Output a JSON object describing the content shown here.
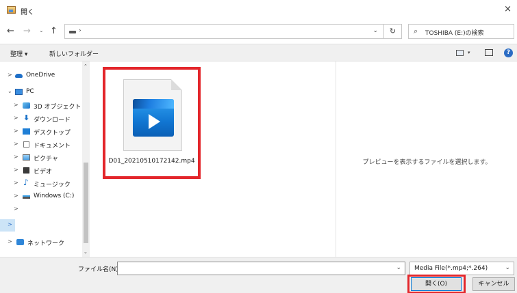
{
  "window": {
    "title": "開く",
    "close_glyph": "×"
  },
  "address_bar": {
    "back_glyph": "←",
    "forward_glyph": "→",
    "recent_glyph": "⌄",
    "up_glyph": "↑",
    "separator": "›",
    "dropdown_glyph": "⌄",
    "refresh_glyph": "↻",
    "search_placeholder": "TOSHIBA (E:)の検索",
    "search_icon_glyph": "⌕"
  },
  "toolbar": {
    "organize_label": "整理 ▾",
    "new_folder_label": "新しいフォルダー",
    "view_dropdown_glyph": "▾",
    "help_glyph": "?"
  },
  "nav_pane": {
    "items": [
      {
        "label": "OneDrive",
        "chevron": ">",
        "icon": "onedrive-cloud-icon"
      },
      {
        "label": "PC",
        "chevron": "⌄",
        "icon": "pc-icon"
      },
      {
        "label": "3D オブジェクト",
        "chevron": ">",
        "icon": "3d-objects-icon"
      },
      {
        "label": "ダウンロード",
        "chevron": ">",
        "icon": "download-icon"
      },
      {
        "label": "デスクトップ",
        "chevron": ">",
        "icon": "desktop-icon"
      },
      {
        "label": "ドキュメント",
        "chevron": ">",
        "icon": "documents-icon"
      },
      {
        "label": "ピクチャ",
        "chevron": ">",
        "icon": "pictures-icon"
      },
      {
        "label": "ビデオ",
        "chevron": ">",
        "icon": "videos-icon"
      },
      {
        "label": "ミュージック",
        "chevron": ">",
        "icon": "music-icon"
      },
      {
        "label": "Windows (C:)",
        "chevron": ">",
        "icon": "drive-icon"
      },
      {
        "label": "",
        "chevron": ">",
        "icon": ""
      },
      {
        "label": "",
        "chevron": ">",
        "icon": ""
      },
      {
        "label": "ネットワーク",
        "chevron": ">",
        "icon": "network-icon"
      }
    ],
    "scroll_up_glyph": "⌃",
    "scroll_down_glyph": "⌄"
  },
  "content": {
    "file_name": "D01_20210510172142.mp4",
    "file_icon": "video-file-icon"
  },
  "preview": {
    "message": "プレビューを表示するファイルを選択します。"
  },
  "bottom": {
    "file_name_label": "ファイル名(N):",
    "file_name_value": "",
    "file_name_dropdown_glyph": "⌄",
    "filter_value": "Media File(*.mp4;*.264)",
    "filter_dropdown_glyph": "⌄",
    "open_label": "開く(O)",
    "cancel_label": "キャンセル"
  },
  "colors": {
    "highlight_red": "#e3262b",
    "accent_blue": "#0078d7",
    "selection_blue": "#cce4f7"
  }
}
